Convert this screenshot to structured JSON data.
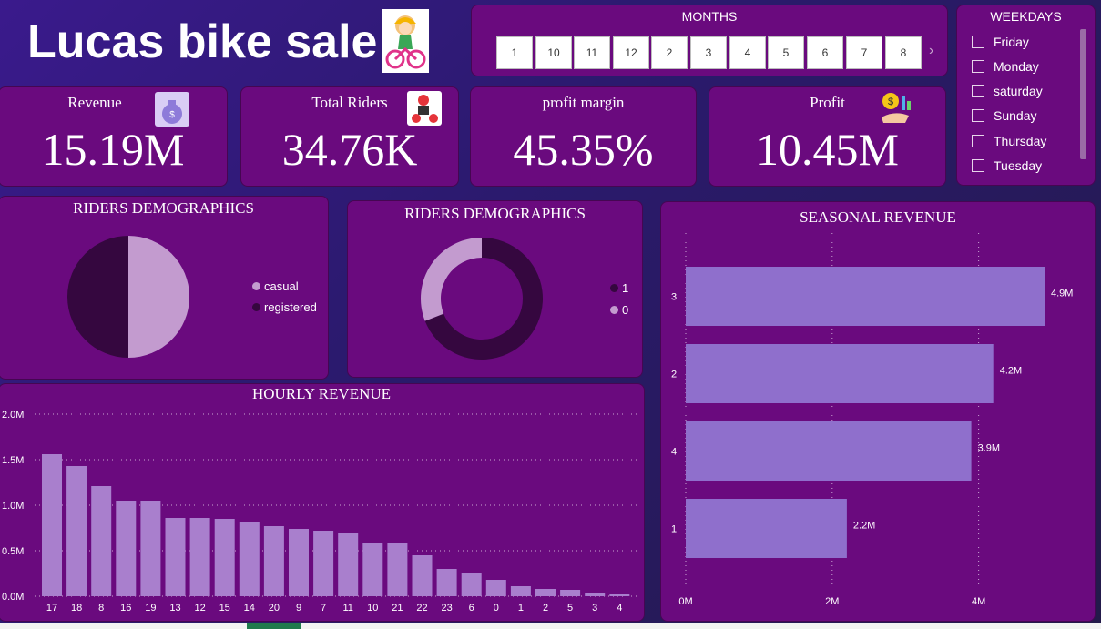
{
  "header": {
    "title": "Lucas bike sale",
    "logo_icon": "cyclist-girl-icon"
  },
  "months": {
    "title": "MONTHS",
    "items": [
      "1",
      "10",
      "11",
      "12",
      "2",
      "3",
      "4",
      "5",
      "6",
      "7",
      "8"
    ],
    "next_icon": "chevron-right-icon"
  },
  "weekdays": {
    "title": "WEEKDAYS",
    "items": [
      "Friday",
      "Monday",
      "saturday",
      "Sunday",
      "Thursday",
      "Tuesday"
    ]
  },
  "kpis": {
    "revenue": {
      "label": "Revenue",
      "value": "15.19M",
      "icon": "money-bag-icon"
    },
    "riders": {
      "label": "Total Riders",
      "value": "34.76K",
      "icon": "scooter-rider-icon"
    },
    "margin": {
      "label": "profit margin",
      "value": "45.35%"
    },
    "profit": {
      "label": "Profit",
      "value": "10.45M",
      "icon": "hand-coin-icon"
    }
  },
  "colors": {
    "panel": "#6a0a7e",
    "light_slice": "#c39bcf",
    "dark_slice": "#35073f",
    "bar_seasonal": "#8f6fcc",
    "bar_hourly": "#a97fcd"
  },
  "chart_data": [
    {
      "type": "pie",
      "title": "RIDERS DEMOGRAPHICS",
      "categories": [
        "casual",
        "registered"
      ],
      "values": [
        50,
        50
      ],
      "legend": "right"
    },
    {
      "type": "pie",
      "subtype": "donut",
      "title": "RIDERS DEMOGRAPHICS",
      "categories": [
        "1",
        "0"
      ],
      "values": [
        69,
        31
      ],
      "legend": "right"
    },
    {
      "type": "bar",
      "orientation": "horizontal",
      "title": "SEASONAL REVENUE",
      "categories": [
        "3",
        "2",
        "4",
        "1"
      ],
      "values": [
        4.9,
        4.2,
        3.9,
        2.2
      ],
      "data_labels": [
        "4.9M",
        "4.2M",
        "3.9M",
        "2.2M"
      ],
      "x_ticks": [
        "0M",
        "2M",
        "4M"
      ],
      "xlim": [
        0,
        4.9
      ],
      "grid": true
    },
    {
      "type": "bar",
      "title": "HOURLY REVENUE",
      "categories": [
        "17",
        "18",
        "8",
        "16",
        "19",
        "13",
        "12",
        "15",
        "14",
        "20",
        "9",
        "7",
        "11",
        "10",
        "21",
        "22",
        "23",
        "6",
        "0",
        "1",
        "2",
        "5",
        "3",
        "4"
      ],
      "values": [
        1.56,
        1.43,
        1.21,
        1.05,
        1.05,
        0.86,
        0.86,
        0.85,
        0.82,
        0.77,
        0.74,
        0.72,
        0.7,
        0.59,
        0.58,
        0.45,
        0.3,
        0.26,
        0.18,
        0.11,
        0.08,
        0.07,
        0.04,
        0.02
      ],
      "y_ticks": [
        "0.0M",
        "0.5M",
        "1.0M",
        "1.5M",
        "2.0M"
      ],
      "ylim": [
        0,
        2.0
      ],
      "grid": true
    }
  ]
}
